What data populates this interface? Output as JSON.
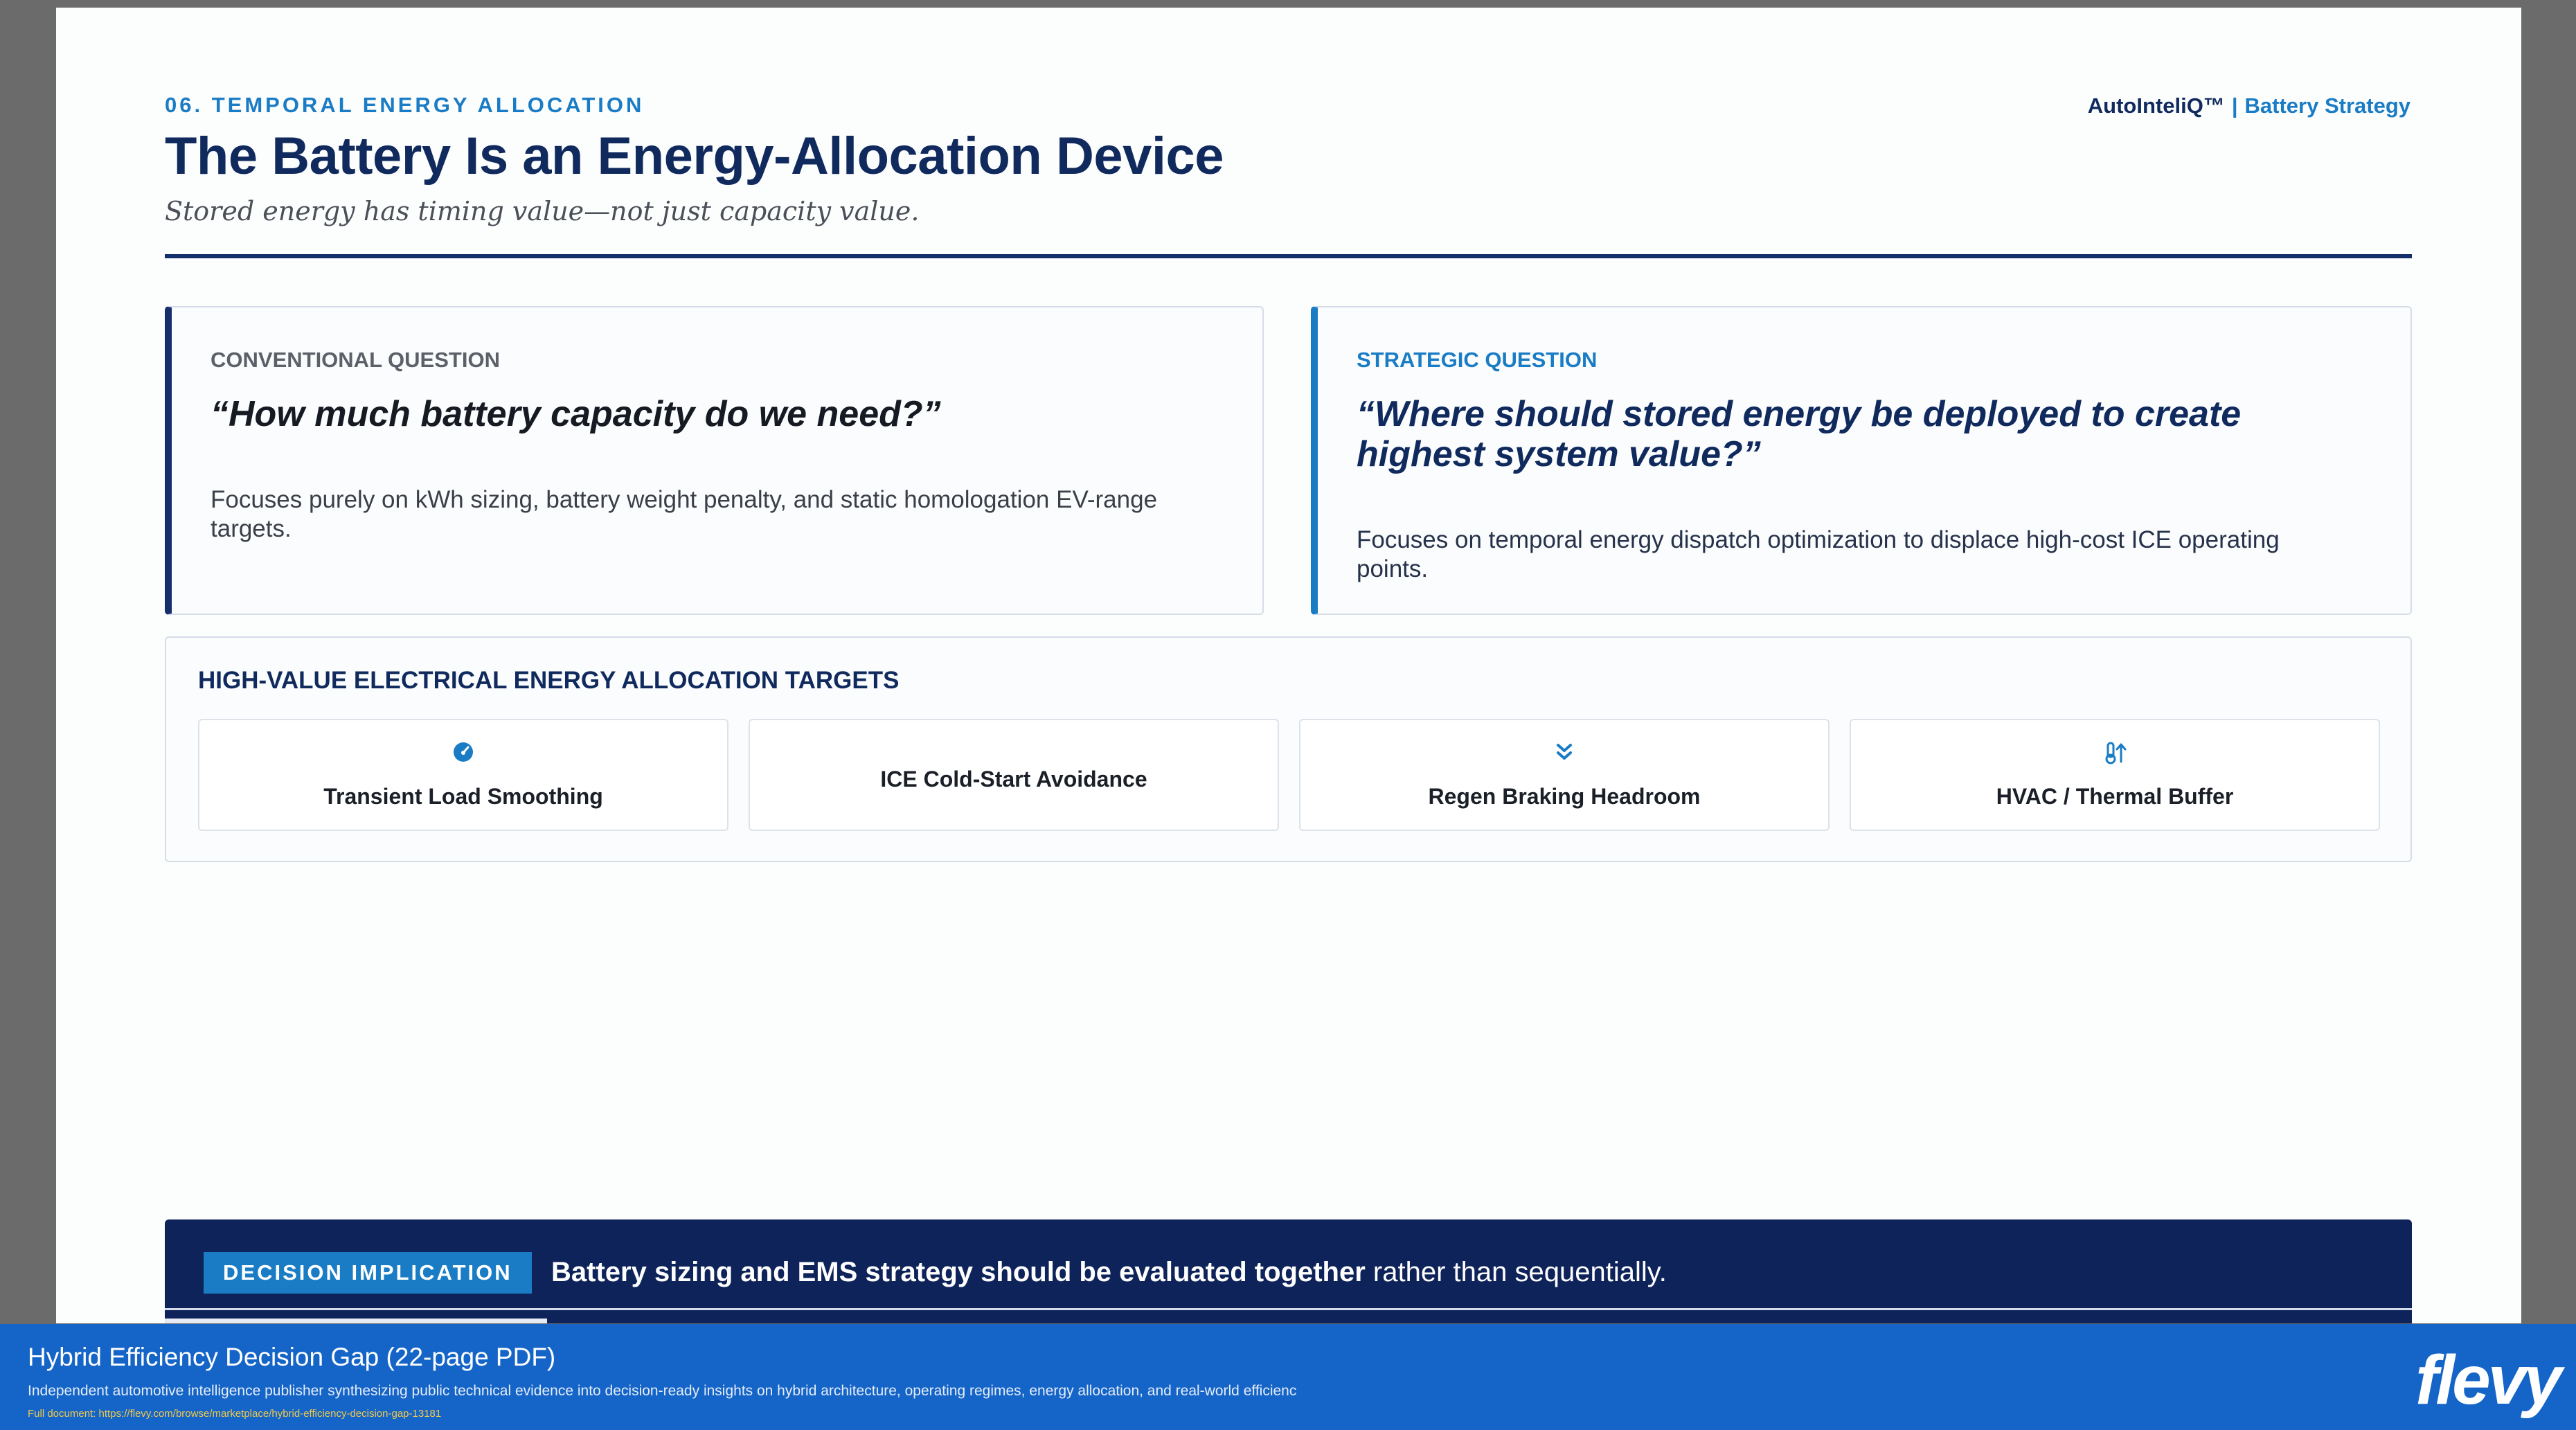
{
  "header": {
    "section_label": "06. TEMPORAL ENERGY ALLOCATION",
    "title": "The Battery Is an Energy-Allocation Device",
    "subtitle": "Stored energy has timing value—not just capacity value.",
    "brand": "AutoInteliQ™",
    "brand_separator": "|",
    "brand_sub": "Battery Strategy"
  },
  "conventional": {
    "label": "CONVENTIONAL QUESTION",
    "question": "“How much battery capacity do we need?”",
    "description": "Focuses purely on kWh sizing, battery weight penalty, and static homologation EV-range targets."
  },
  "strategic": {
    "label": "STRATEGIC QUESTION",
    "question": "“Where should stored energy be deployed to create highest system value?”",
    "description": "Focuses on temporal energy dispatch optimization to displace high-cost ICE operating points."
  },
  "targets": {
    "title": "HIGH-VALUE ELECTRICAL ENERGY ALLOCATION TARGETS",
    "items": [
      {
        "label": "Transient Load Smoothing",
        "icon": "gauge-icon"
      },
      {
        "label": "ICE Cold-Start Avoidance",
        "icon": ""
      },
      {
        "label": "Regen Braking Headroom",
        "icon": "double-chevron-down-icon"
      },
      {
        "label": "HVAC / Thermal Buffer",
        "icon": "thermometer-icon"
      }
    ]
  },
  "decision": {
    "badge": "DECISION IMPLICATION",
    "statement_bold": "Battery sizing and EMS strategy should be evaluated together",
    "statement_rest": " rather than sequentially."
  },
  "footer": {
    "title": "Hybrid Efficiency Decision Gap",
    "pages": "(22-page PDF)",
    "description": "Independent automotive intelligence publisher synthesizing public technical evidence into decision-ready insights on hybrid architecture, operating regimes, energy allocation, and real-world efficienc",
    "link": "Full document: https://flevy.com/browse/marketplace/hybrid-efficiency-decision-gap-13181",
    "logo": "flevy"
  },
  "colors": {
    "navy": "#102a5e",
    "accent_blue": "#1a7cc5",
    "decision_bg": "#0e2359",
    "footer_bg": "#1565c8",
    "link_yellow": "#f1c94a"
  }
}
